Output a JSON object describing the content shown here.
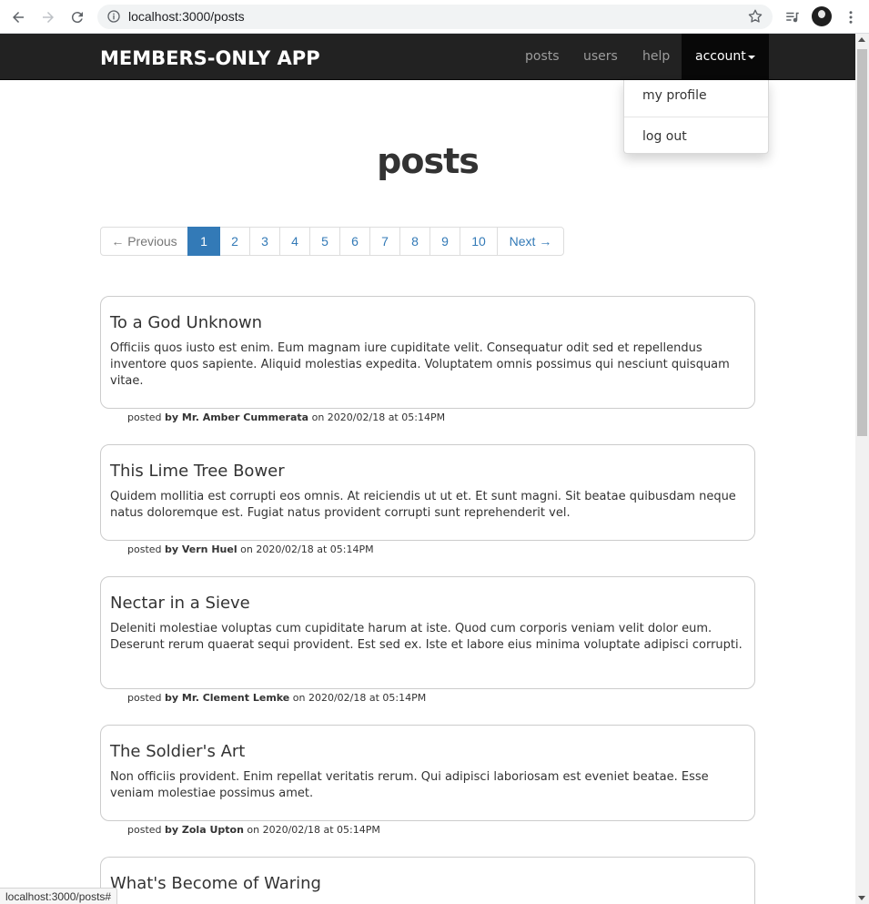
{
  "browser": {
    "url": "localhost:3000/posts",
    "status_url": "localhost:3000/posts#"
  },
  "navbar": {
    "brand": "MEMBERS-ONLY APP",
    "links": [
      "posts",
      "users",
      "help"
    ],
    "account_label": "account",
    "dropdown": [
      "my profile",
      "log out"
    ]
  },
  "page": {
    "title": "posts"
  },
  "pagination": {
    "previous": "← Previous",
    "pages": [
      "1",
      "2",
      "3",
      "4",
      "5",
      "6",
      "7",
      "8",
      "9",
      "10"
    ],
    "next": "Next →",
    "current": "1"
  },
  "posts": [
    {
      "title": "To a God Unknown",
      "body": "Officiis quos iusto est enim. Eum magnam iure cupiditate velit. Consequatur odit sed et repellendus inventore quos sapiente. Aliquid molestias expedita. Voluptatem omnis possimus qui nesciunt quisquam vitae.",
      "posted": "posted",
      "author": "by Mr. Amber Cummerata",
      "date": "on 2020/02/18 at 05:14PM"
    },
    {
      "title": "This Lime Tree Bower",
      "body": "Quidem mollitia est corrupti eos omnis. At reiciendis ut ut et. Et sunt magni. Sit beatae quibusdam neque natus doloremque est. Fugiat natus provident corrupti sunt reprehenderit vel.",
      "posted": "posted",
      "author": "by Vern Huel",
      "date": "on 2020/02/18 at 05:14PM"
    },
    {
      "title": "Nectar in a Sieve",
      "body": "Deleniti molestiae voluptas cum cupiditate harum at iste. Quod cum corporis veniam velit dolor eum. Deserunt rerum quaerat sequi provident. Est sed ex. Iste et labore eius minima voluptate adipisci corrupti.",
      "posted": "posted",
      "author": "by Mr. Clement Lemke",
      "date": "on 2020/02/18 at 05:14PM"
    },
    {
      "title": "The Soldier's Art",
      "body": "Non officiis provident. Enim repellat veritatis rerum. Qui adipisci laboriosam est eveniet beatae. Esse veniam molestiae possimus amet.",
      "posted": "posted",
      "author": "by Zola Upton",
      "date": "on 2020/02/18 at 05:14PM"
    },
    {
      "title": "What's Become of Waring"
    }
  ],
  "colors": {
    "navbar_bg": "#222222",
    "link_blue": "#337ab7",
    "active_page_bg": "#337ab7"
  }
}
